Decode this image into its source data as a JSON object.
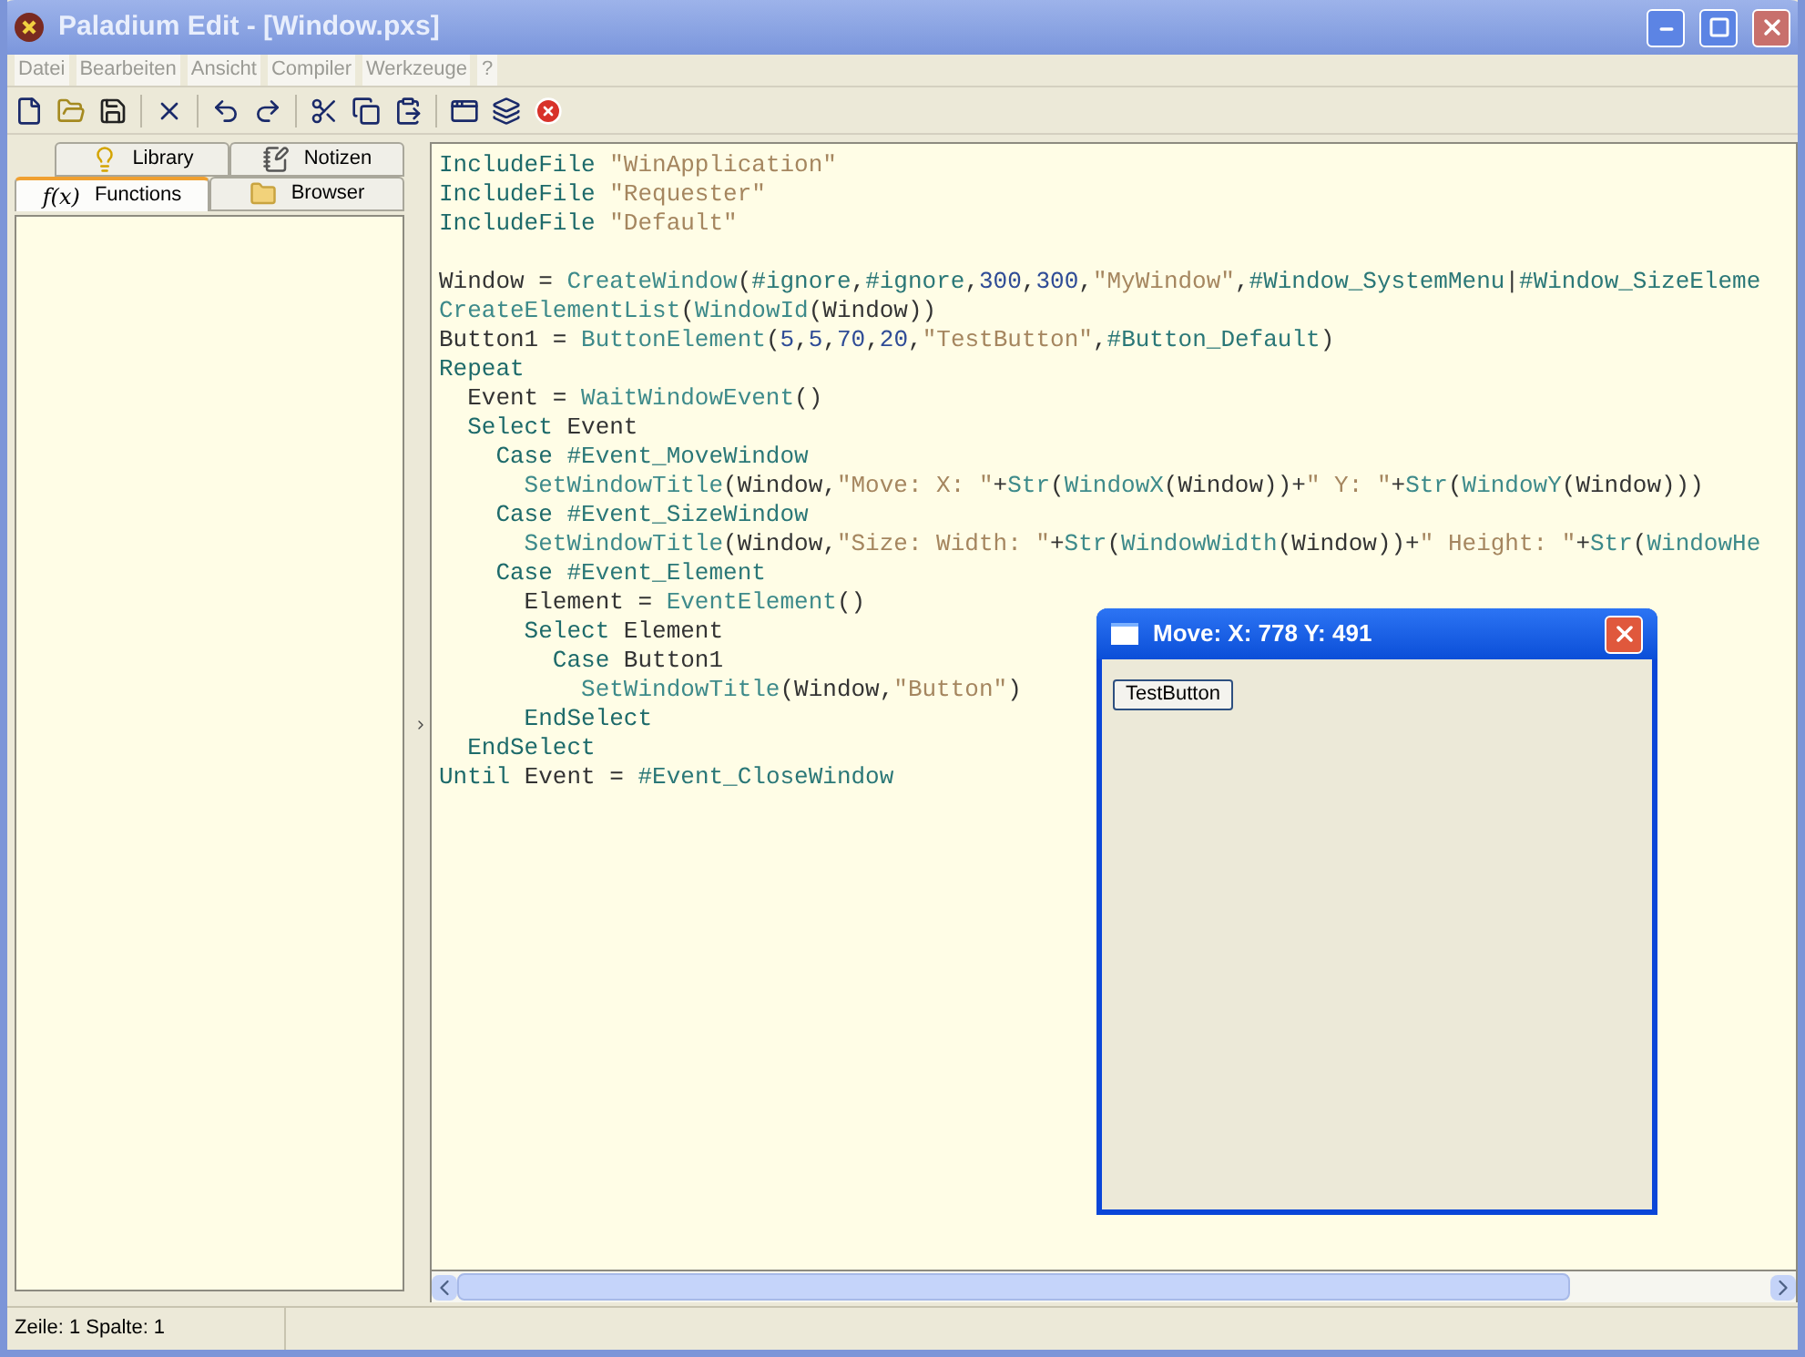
{
  "window": {
    "title": "Paladium Edit - [Window.pxs]"
  },
  "menu": [
    {
      "label": "Datei",
      "disabled": true
    },
    {
      "label": "Bearbeiten",
      "disabled": true
    },
    {
      "label": "Ansicht",
      "disabled": true
    },
    {
      "label": "Compiler",
      "disabled": true
    },
    {
      "label": "Werkzeuge",
      "disabled": true
    },
    {
      "label": "?",
      "disabled": true
    }
  ],
  "side_tabs": [
    [
      {
        "label": "Library",
        "selected": false
      },
      {
        "label": "Notizen",
        "selected": false
      }
    ],
    [
      {
        "label": "Functions",
        "selected": true,
        "glyph": "f(x)"
      },
      {
        "label": "Browser",
        "selected": false
      }
    ]
  ],
  "code_lines": [
    {
      "kind": "code",
      "tokens": [
        {
          "kind": "kw",
          "text": "IncludeFile "
        },
        {
          "kind": "str",
          "text": "\"WinApplication\""
        }
      ]
    },
    {
      "kind": "code",
      "tokens": [
        {
          "kind": "kw",
          "text": "IncludeFile "
        },
        {
          "kind": "str",
          "text": "\"Requester\""
        }
      ]
    },
    {
      "kind": "code",
      "tokens": [
        {
          "kind": "kw",
          "text": "IncludeFile "
        },
        {
          "kind": "str",
          "text": "\"Default\""
        }
      ]
    },
    {
      "kind": "blank"
    },
    {
      "kind": "code",
      "tokens": [
        {
          "kind": "plain",
          "text": "Window = "
        },
        {
          "kind": "fn",
          "text": "CreateWindow"
        },
        {
          "kind": "plain",
          "text": "("
        },
        {
          "kind": "const",
          "text": "#ignore"
        },
        {
          "kind": "plain",
          "text": ","
        },
        {
          "kind": "const",
          "text": "#ignore"
        },
        {
          "kind": "plain",
          "text": ","
        },
        {
          "kind": "num",
          "text": "300"
        },
        {
          "kind": "plain",
          "text": ","
        },
        {
          "kind": "num",
          "text": "300"
        },
        {
          "kind": "plain",
          "text": ","
        },
        {
          "kind": "str",
          "text": "\"MyWindow\""
        },
        {
          "kind": "plain",
          "text": ","
        },
        {
          "kind": "const",
          "text": "#Window_SystemMenu"
        },
        {
          "kind": "plain",
          "text": "|"
        },
        {
          "kind": "const",
          "text": "#Window_SizeEleme"
        }
      ]
    },
    {
      "kind": "code",
      "tokens": [
        {
          "kind": "fn",
          "text": "CreateElementList"
        },
        {
          "kind": "plain",
          "text": "("
        },
        {
          "kind": "fn",
          "text": "WindowId"
        },
        {
          "kind": "plain",
          "text": "(Window))"
        }
      ]
    },
    {
      "kind": "code",
      "tokens": [
        {
          "kind": "plain",
          "text": "Button1 = "
        },
        {
          "kind": "fn",
          "text": "ButtonElement"
        },
        {
          "kind": "plain",
          "text": "("
        },
        {
          "kind": "num",
          "text": "5"
        },
        {
          "kind": "plain",
          "text": ","
        },
        {
          "kind": "num",
          "text": "5"
        },
        {
          "kind": "plain",
          "text": ","
        },
        {
          "kind": "num",
          "text": "70"
        },
        {
          "kind": "plain",
          "text": ","
        },
        {
          "kind": "num",
          "text": "20"
        },
        {
          "kind": "plain",
          "text": ","
        },
        {
          "kind": "str",
          "text": "\"TestButton\""
        },
        {
          "kind": "plain",
          "text": ","
        },
        {
          "kind": "const",
          "text": "#Button_Default"
        },
        {
          "kind": "plain",
          "text": ")"
        }
      ]
    },
    {
      "kind": "code",
      "tokens": [
        {
          "kind": "kw",
          "text": "Repeat"
        }
      ]
    },
    {
      "kind": "code",
      "tokens": [
        {
          "kind": "plain",
          "text": "  Event = "
        },
        {
          "kind": "fn",
          "text": "WaitWindowEvent"
        },
        {
          "kind": "plain",
          "text": "()"
        }
      ]
    },
    {
      "kind": "code",
      "tokens": [
        {
          "kind": "kw",
          "text": "  Select "
        },
        {
          "kind": "plain",
          "text": "Event"
        }
      ]
    },
    {
      "kind": "code",
      "tokens": [
        {
          "kind": "kw",
          "text": "    Case "
        },
        {
          "kind": "const",
          "text": "#Event_MoveWindow"
        }
      ]
    },
    {
      "kind": "code",
      "tokens": [
        {
          "kind": "fn",
          "text": "      SetWindowTitle"
        },
        {
          "kind": "plain",
          "text": "(Window,"
        },
        {
          "kind": "str",
          "text": "\"Move: X: \""
        },
        {
          "kind": "plain",
          "text": "+"
        },
        {
          "kind": "fn",
          "text": "Str"
        },
        {
          "kind": "plain",
          "text": "("
        },
        {
          "kind": "fn",
          "text": "WindowX"
        },
        {
          "kind": "plain",
          "text": "(Window))+"
        },
        {
          "kind": "str",
          "text": "\" Y: \""
        },
        {
          "kind": "plain",
          "text": "+"
        },
        {
          "kind": "fn",
          "text": "Str"
        },
        {
          "kind": "plain",
          "text": "("
        },
        {
          "kind": "fn",
          "text": "WindowY"
        },
        {
          "kind": "plain",
          "text": "(Window)))"
        }
      ]
    },
    {
      "kind": "code",
      "tokens": [
        {
          "kind": "kw",
          "text": "    Case "
        },
        {
          "kind": "const",
          "text": "#Event_SizeWindow"
        }
      ]
    },
    {
      "kind": "code",
      "tokens": [
        {
          "kind": "fn",
          "text": "      SetWindowTitle"
        },
        {
          "kind": "plain",
          "text": "(Window,"
        },
        {
          "kind": "str",
          "text": "\"Size: Width: \""
        },
        {
          "kind": "plain",
          "text": "+"
        },
        {
          "kind": "fn",
          "text": "Str"
        },
        {
          "kind": "plain",
          "text": "("
        },
        {
          "kind": "fn",
          "text": "WindowWidth"
        },
        {
          "kind": "plain",
          "text": "(Window))+"
        },
        {
          "kind": "str",
          "text": "\" Height: \""
        },
        {
          "kind": "plain",
          "text": "+"
        },
        {
          "kind": "fn",
          "text": "Str"
        },
        {
          "kind": "plain",
          "text": "("
        },
        {
          "kind": "fn",
          "text": "WindowHe"
        }
      ]
    },
    {
      "kind": "code",
      "tokens": [
        {
          "kind": "kw",
          "text": "    Case "
        },
        {
          "kind": "const",
          "text": "#Event_Element"
        }
      ]
    },
    {
      "kind": "code",
      "tokens": [
        {
          "kind": "plain",
          "text": "      Element = "
        },
        {
          "kind": "fn",
          "text": "EventElement"
        },
        {
          "kind": "plain",
          "text": "()"
        }
      ]
    },
    {
      "kind": "code",
      "tokens": [
        {
          "kind": "kw",
          "text": "      Select "
        },
        {
          "kind": "plain",
          "text": "Element"
        }
      ]
    },
    {
      "kind": "code",
      "tokens": [
        {
          "kind": "kw",
          "text": "        Case "
        },
        {
          "kind": "plain",
          "text": "Button1"
        }
      ]
    },
    {
      "kind": "code",
      "tokens": [
        {
          "kind": "fn",
          "text": "          SetWindowTitle"
        },
        {
          "kind": "plain",
          "text": "(Window,"
        },
        {
          "kind": "str",
          "text": "\"Button\""
        },
        {
          "kind": "plain",
          "text": ")"
        }
      ]
    },
    {
      "kind": "code",
      "tokens": [
        {
          "kind": "kw",
          "text": "      EndSelect"
        }
      ]
    },
    {
      "kind": "code",
      "tokens": [
        {
          "kind": "kw",
          "text": "  EndSelect"
        }
      ]
    },
    {
      "kind": "code",
      "tokens": [
        {
          "kind": "kw",
          "text": "Until "
        },
        {
          "kind": "plain",
          "text": "Event = "
        },
        {
          "kind": "const",
          "text": "#Event_CloseWindow"
        }
      ]
    }
  ],
  "test_window": {
    "title": "Move: X: 778 Y: 491",
    "button": "TestButton"
  },
  "status_bar": [
    "Zeile: 1 Spalte: 1"
  ]
}
